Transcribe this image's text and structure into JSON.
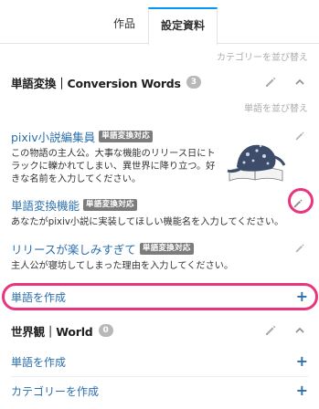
{
  "tabs": [
    {
      "label": "作品"
    },
    {
      "label": "設定資料"
    }
  ],
  "category_sort_label": "カテゴリーを並び替え",
  "sections": {
    "conversion": {
      "title": "単語変換｜Conversion Words",
      "count": "3",
      "word_sort_label": "単語を並び替え",
      "words": [
        {
          "title": "pixiv小説編集員",
          "tag": "単語変換対応",
          "desc": "この物語の主人公。大事な機能のリリース日にトラックに轢かれてしまい、異世界に降り立つ。好きな名前を入力してください。"
        },
        {
          "title": "単語変換機能",
          "tag": "単語変換対応",
          "desc": "あなたがpixiv小説に実装してほしい機能名を入力してください。"
        },
        {
          "title": "リリースが楽しみすぎて",
          "tag": "単語変換対応",
          "desc": "主人公が寝坊してしまった理由を入力してください。"
        }
      ],
      "create_word_label": "単語を作成"
    },
    "world": {
      "title": "世界観｜World",
      "count": "0",
      "create_word_label": "単語を作成",
      "create_category_label": "カテゴリーを作成"
    }
  },
  "icons": {
    "edit": "pencil-icon",
    "collapse": "chevron-up-icon",
    "add": "plus-icon"
  },
  "colors": {
    "accent_blue": "#0096fa",
    "link": "#2b6fad",
    "highlight": "#e8357e",
    "tag_bg": "#7c7c7c"
  }
}
